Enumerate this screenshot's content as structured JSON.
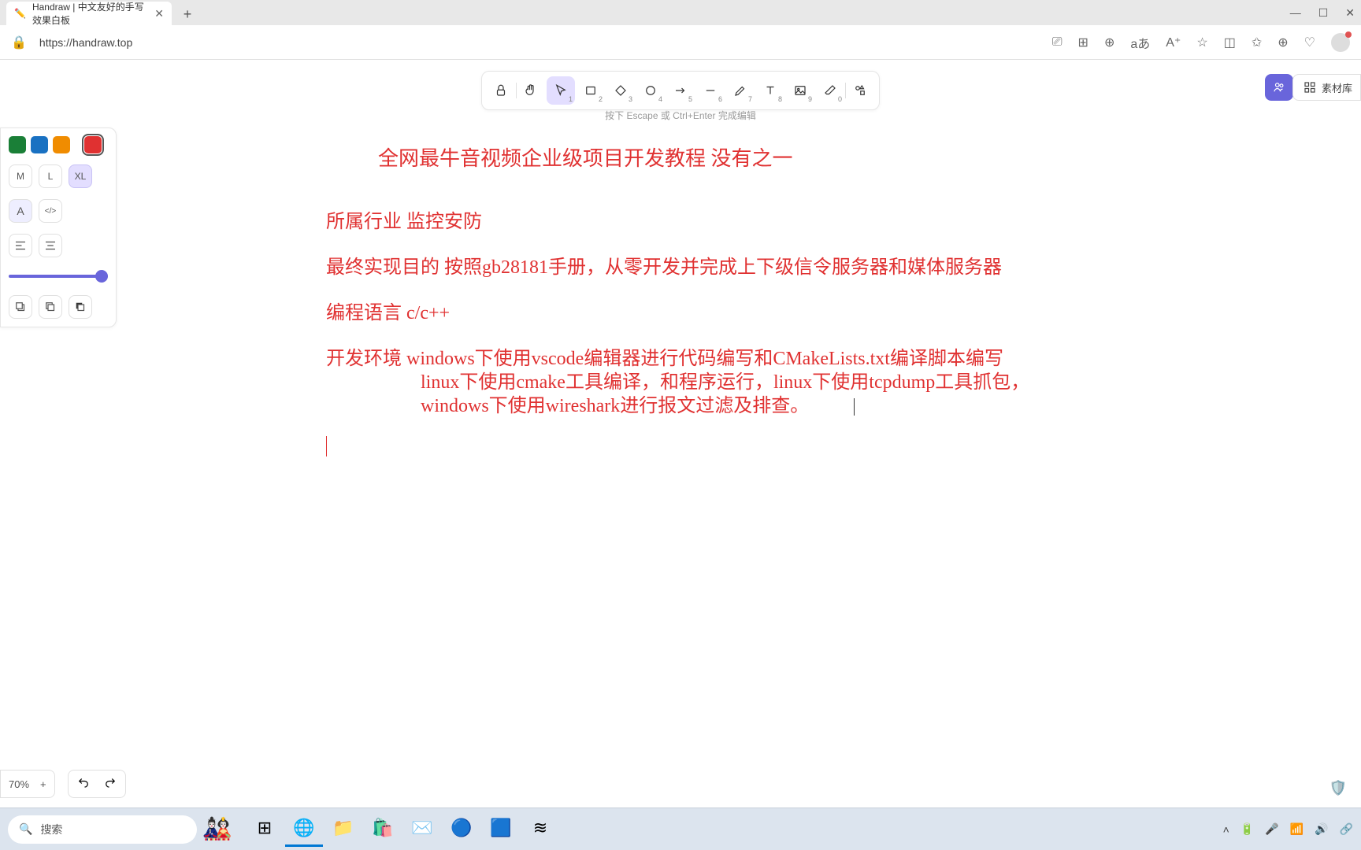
{
  "browser": {
    "tab_title": "Handraw | 中文友好的手写效果白板",
    "url": "https://handraw.top",
    "window": {
      "minimize": "—",
      "maximize": "☐",
      "close": "✕"
    }
  },
  "toolbar": {
    "tools": [
      {
        "name": "lock",
        "sub": ""
      },
      {
        "name": "hand",
        "sub": ""
      },
      {
        "name": "select",
        "sub": "1"
      },
      {
        "name": "rectangle",
        "sub": "2"
      },
      {
        "name": "diamond",
        "sub": "3"
      },
      {
        "name": "ellipse",
        "sub": "4"
      },
      {
        "name": "arrow",
        "sub": "5"
      },
      {
        "name": "line",
        "sub": "6"
      },
      {
        "name": "draw",
        "sub": "7"
      },
      {
        "name": "text",
        "sub": "8"
      },
      {
        "name": "image",
        "sub": "9"
      },
      {
        "name": "eraser",
        "sub": "0"
      },
      {
        "name": "more",
        "sub": ""
      }
    ],
    "library_label": "素材库"
  },
  "hint": "按下 Escape 或 Ctrl+Enter 完成编辑",
  "side": {
    "colors": [
      "#1a7f37",
      "#1971c2",
      "#f08c00",
      "#e03131"
    ],
    "selected_color": "#e03131",
    "sizes": [
      "M",
      "L",
      "XL"
    ],
    "selected_size": "XL",
    "fonts": [
      "A",
      "</>"
    ],
    "opacity": 100
  },
  "canvas": {
    "title": "全网最牛音视频企业级项目开发教程  没有之一",
    "l1": "所属行业     监控安防",
    "l2": "最终实现目的    按照gb28181手册，从零开发并完成上下级信令服务器和媒体服务器",
    "l3": "编程语言    c/c++",
    "l4a": "开发环境   windows下使用vscode编辑器进行代码编写和CMakeLists.txt编译脚本编写",
    "l4b": "linux下使用cmake工具编译，和程序运行，linux下使用tcpdump工具抓包，",
    "l4c": "windows下使用wireshark进行报文过滤及排查。"
  },
  "zoom": {
    "value": "70%",
    "plus": "+"
  },
  "taskbar": {
    "search_placeholder": "搜索"
  }
}
